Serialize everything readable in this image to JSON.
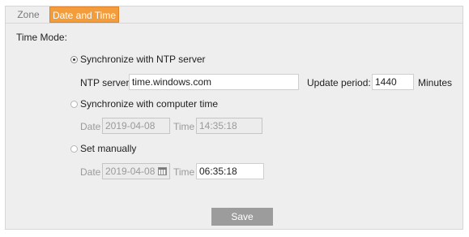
{
  "tabs": [
    {
      "label": "Zone",
      "active": false
    },
    {
      "label": "Date and Time",
      "active": true
    }
  ],
  "time_mode": {
    "label": "Time Mode:",
    "selected": "ntp",
    "options": {
      "ntp": {
        "label": "Synchronize with NTP server",
        "server_label": "NTP server:",
        "server_value": "time.windows.com",
        "period_label": "Update period:",
        "period_value": "1440",
        "period_unit": "Minutes"
      },
      "computer": {
        "label": "Synchronize with computer time",
        "date_label": "Date",
        "date_value": "2019-04-08",
        "time_label": "Time",
        "time_value": "14:35:18"
      },
      "manual": {
        "label": "Set manually",
        "date_label": "Date",
        "date_value": "2019-04-08",
        "time_label": "Time",
        "time_value": "06:35:18",
        "calendar_icon": "calendar-icon"
      }
    }
  },
  "save_label": "Save",
  "colors": {
    "tab_active_bg": "#f39c3c",
    "panel_bg": "#eeeeee",
    "save_bg": "#9c9c9c"
  }
}
